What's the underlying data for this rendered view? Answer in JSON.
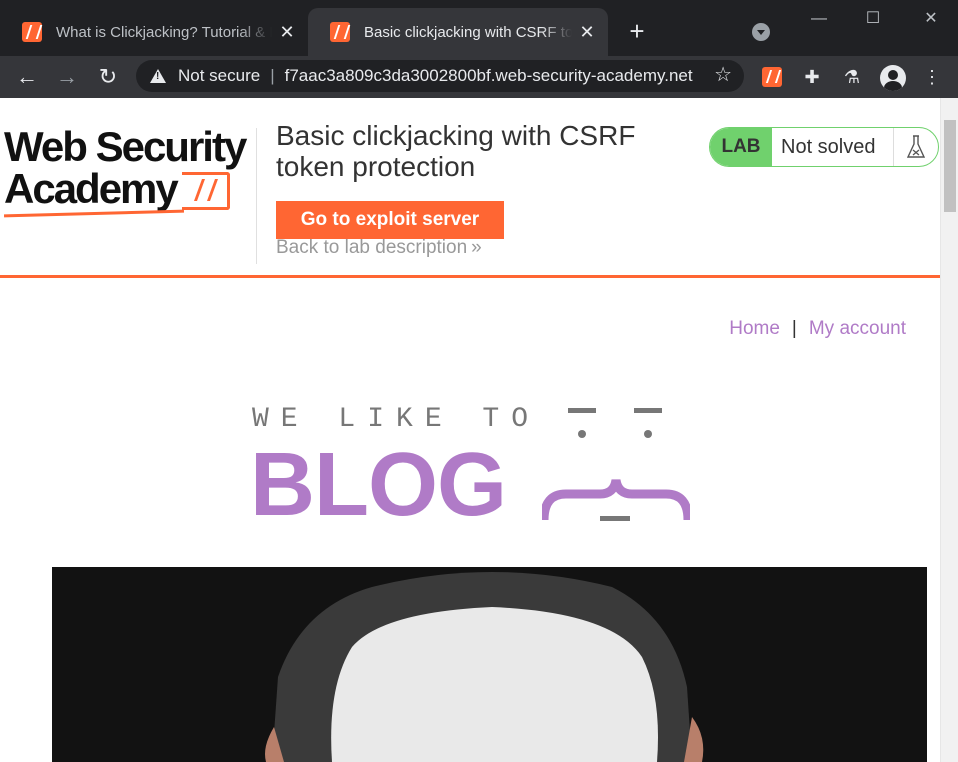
{
  "browser": {
    "tabs": [
      {
        "title": "What is Clickjacking? Tutorial & Examples | Web Security Academy",
        "active": false
      },
      {
        "title": "Basic clickjacking with CSRF token protection",
        "active": true
      }
    ],
    "new_tab_label": "+",
    "window_controls": {
      "minimize": "—",
      "maximize": "☐",
      "close": "✕"
    },
    "security_label": "Not secure",
    "url": "f7aac3a809c3da3002800bf.web-security-academy.net",
    "icons": [
      "back-icon",
      "forward-icon",
      "reload-icon",
      "star-icon",
      "burp-extension-icon",
      "puzzle-icon",
      "flask-icon",
      "profile-icon",
      "kebab-menu-icon"
    ]
  },
  "lab_header": {
    "logo_line1": "Web Security",
    "logo_line2": "Academy",
    "title": "Basic clickjacking with CSRF token protection",
    "exploit_button": "Go to exploit server",
    "back_link": "Back to lab description",
    "back_chevron": "»",
    "status_badge": "LAB",
    "status_text": "Not solved",
    "accent_color": "#ff6633",
    "status_color": "#70d16d"
  },
  "nav": {
    "home": "Home",
    "separator": "|",
    "account": "My account",
    "link_color": "#b07bc7"
  },
  "banner": {
    "tagline": "WE LIKE TO",
    "word": "BLOG"
  }
}
